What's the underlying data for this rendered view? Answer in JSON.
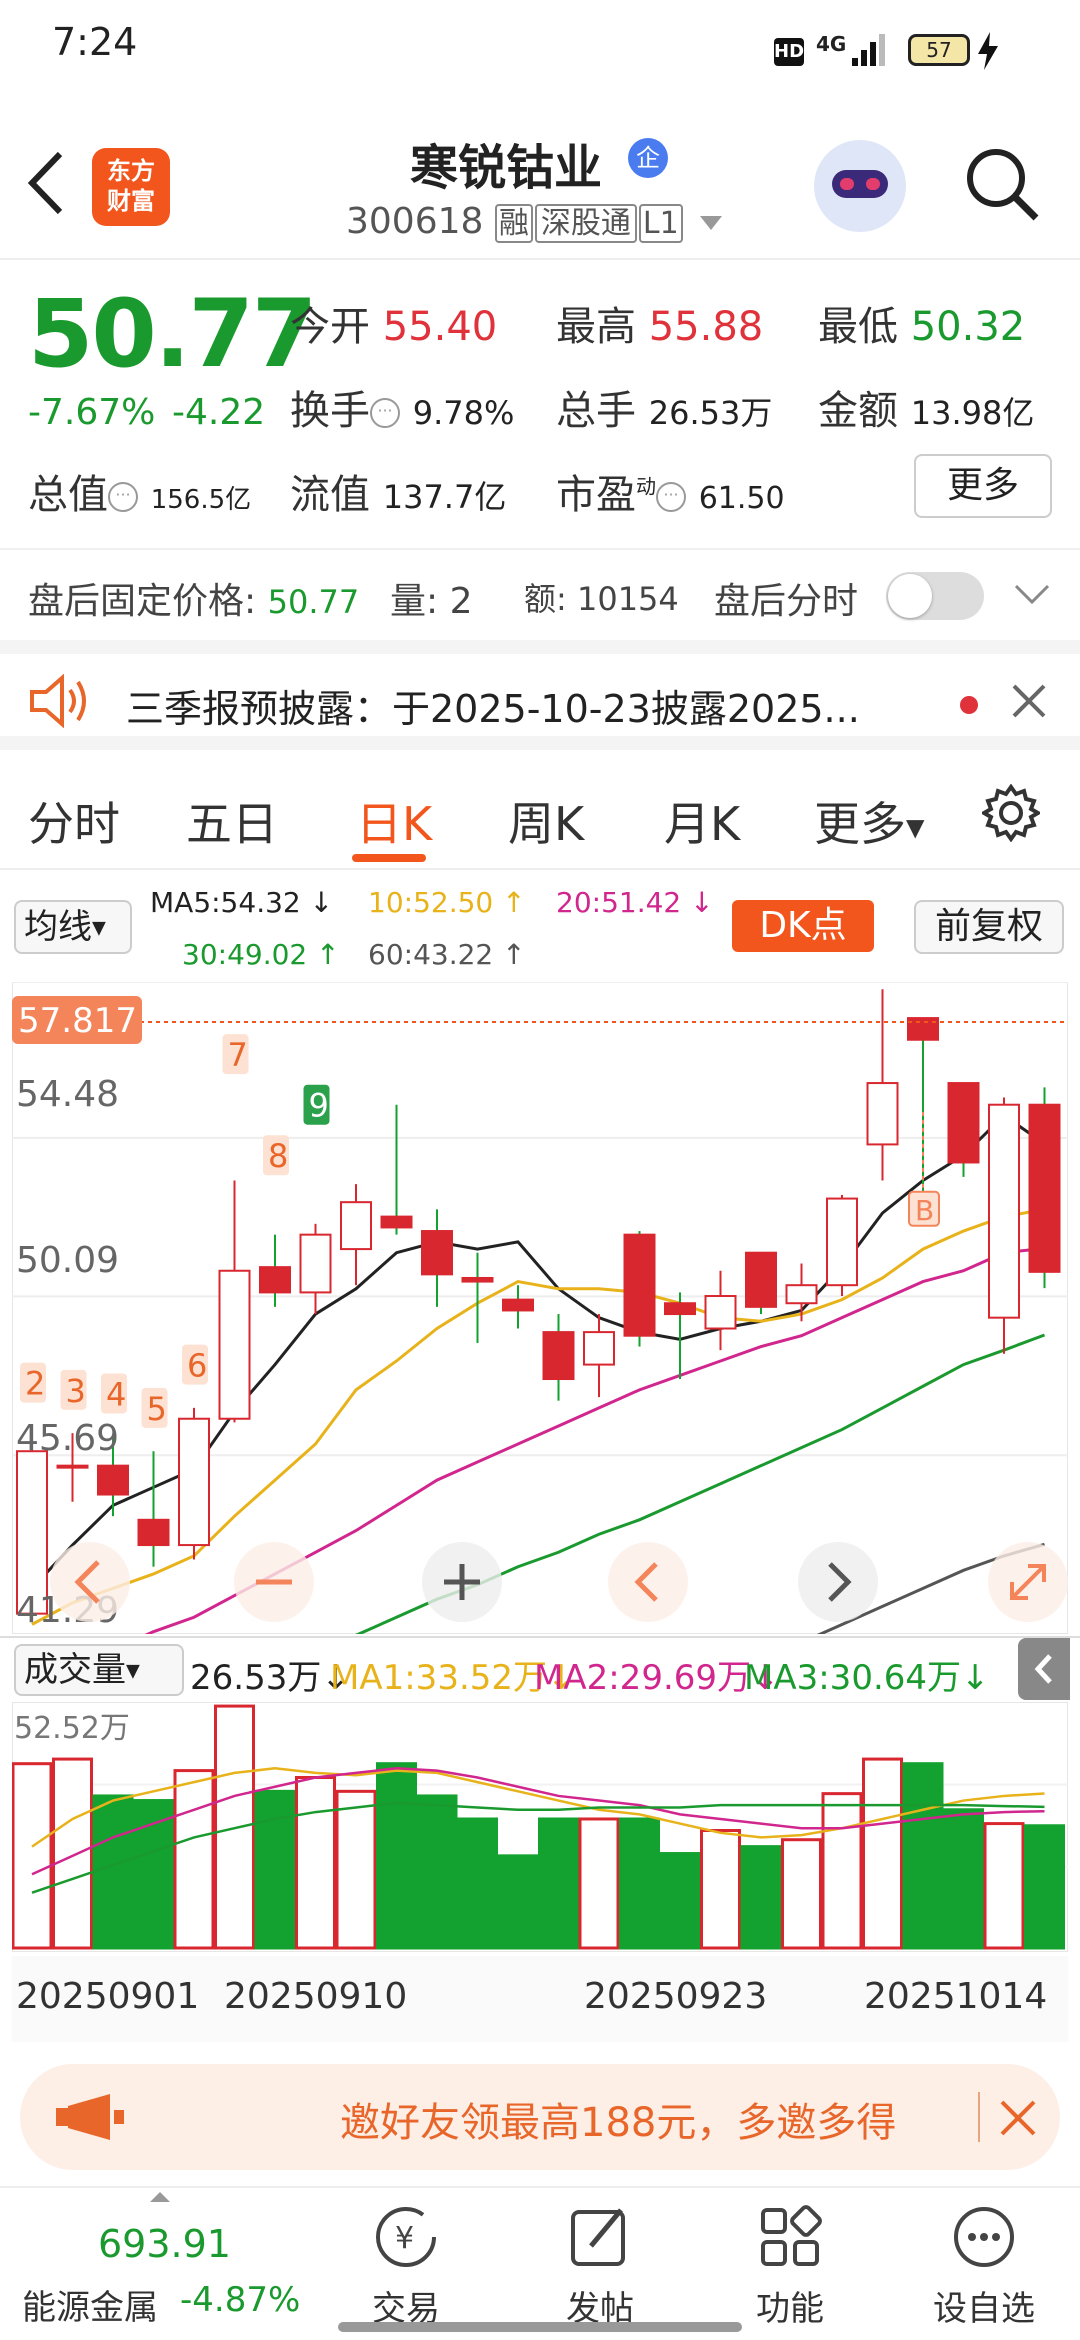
{
  "status_bar": {
    "time": "7:24",
    "hd": "HD",
    "network": "4G",
    "battery": "57"
  },
  "header": {
    "logo_line1": "东方",
    "logo_line2": "财富",
    "stock_name": "寒锐钴业",
    "enterprise_badge": "企",
    "stock_code": "300618",
    "tag_margin": "融",
    "tag_connect": "深股通",
    "tag_level": "L1"
  },
  "quote": {
    "price": "50.77",
    "change_pct": "-7.67%",
    "change_amt": "-4.22",
    "open_label": "今开",
    "open": "55.40",
    "high_label": "最高",
    "high": "55.88",
    "low_label": "最低",
    "low": "50.32",
    "turnover_label": "换手",
    "turnover": "9.78%",
    "volume_label": "总手",
    "volume": "26.53万",
    "amount_label": "金额",
    "amount": "13.98亿",
    "mktcap_label": "总值",
    "mktcap": "156.5亿",
    "float_label": "流值",
    "float_cap": "137.7亿",
    "pe_label": "市盈",
    "pe_super": "动",
    "pe": "61.50",
    "more_button": "更多"
  },
  "after_hours": {
    "fixed_price_label": "盘后固定价格:",
    "fixed_price": "50.77",
    "qty_label": "量:",
    "qty": "2",
    "amt_label": "额:",
    "amt": "10154",
    "timeshare_label": "盘后分时"
  },
  "notice": {
    "text": "三季报预披露：于2025-10-23披露2025..."
  },
  "tabs": [
    "分时",
    "五日",
    "日K",
    "周K",
    "月K",
    "更多"
  ],
  "active_tab": 2,
  "chart_toolbar": {
    "ma_select": "均线",
    "ma5": "MA5:54.32",
    "ma10": "10:52.50",
    "ma20": "20:51.42",
    "ma30": "30:49.02",
    "ma60": "60:43.22",
    "dk_button": "DK点",
    "adjust_button": "前复权"
  },
  "price_axis": {
    "current_tag": "57.817",
    "labels": [
      "54.48",
      "50.09",
      "45.69",
      "41.29"
    ]
  },
  "signals": [
    "2",
    "3",
    "4",
    "5",
    "6",
    "7",
    "8",
    "9"
  ],
  "buy_signal": "B",
  "volume_bar": {
    "select": "成交量",
    "volume": "26.53万",
    "ma1": "MA1:33.52万",
    "ma2": "MA2:29.69万",
    "ma3": "MA3:30.64万",
    "vol_axis": "52.52万"
  },
  "dates": [
    "20250901",
    "20250910",
    "20250923",
    "20251014"
  ],
  "promo": {
    "text": "邀好友领最高188元，多邀多得"
  },
  "bottom_nav": {
    "index_value": "693.91",
    "index_name": "能源金属",
    "index_change": "-4.87%",
    "items": [
      "交易",
      "发帖",
      "功能",
      "设自选"
    ]
  },
  "chart_data": {
    "type": "candlestick",
    "ylim": [
      41.29,
      58.8
    ],
    "candles": [
      {
        "o": 41.3,
        "c": 45.8,
        "h": 46.5,
        "l": 41.2
      },
      {
        "o": 45.4,
        "c": 45.4,
        "h": 46.3,
        "l": 44.4
      },
      {
        "o": 45.4,
        "c": 44.6,
        "h": 46.2,
        "l": 44.0
      },
      {
        "o": 43.9,
        "c": 43.2,
        "h": 45.8,
        "l": 42.6
      },
      {
        "o": 43.2,
        "c": 46.7,
        "h": 47.0,
        "l": 42.8
      },
      {
        "o": 46.7,
        "c": 50.8,
        "h": 53.3,
        "l": 46.6
      },
      {
        "o": 50.9,
        "c": 50.2,
        "h": 51.8,
        "l": 49.8
      },
      {
        "o": 50.2,
        "c": 51.8,
        "h": 52.1,
        "l": 49.6
      },
      {
        "o": 51.4,
        "c": 52.7,
        "h": 53.2,
        "l": 50.4
      },
      {
        "o": 52.3,
        "c": 52.0,
        "h": 55.4,
        "l": 51.8
      },
      {
        "o": 51.9,
        "c": 50.7,
        "h": 52.5,
        "l": 49.8
      },
      {
        "o": 50.6,
        "c": 50.5,
        "h": 51.3,
        "l": 48.8
      },
      {
        "o": 50.0,
        "c": 49.7,
        "h": 50.4,
        "l": 49.2
      },
      {
        "o": 49.1,
        "c": 47.8,
        "h": 49.6,
        "l": 47.2
      },
      {
        "o": 48.2,
        "c": 49.1,
        "h": 49.6,
        "l": 47.3
      },
      {
        "o": 51.8,
        "c": 49.0,
        "h": 51.9,
        "l": 48.7
      },
      {
        "o": 49.9,
        "c": 49.6,
        "h": 50.2,
        "l": 47.8
      },
      {
        "o": 49.2,
        "c": 50.1,
        "h": 50.8,
        "l": 48.6
      },
      {
        "o": 51.3,
        "c": 49.8,
        "h": 51.3,
        "l": 49.6
      },
      {
        "o": 49.9,
        "c": 50.4,
        "h": 51.0,
        "l": 49.4
      },
      {
        "o": 50.4,
        "c": 52.8,
        "h": 52.9,
        "l": 50.1
      },
      {
        "o": 54.3,
        "c": 56.0,
        "h": 58.6,
        "l": 53.3
      },
      {
        "o": 57.8,
        "c": 57.2,
        "h": 57.8,
        "l": 52.5
      },
      {
        "o": 56.0,
        "c": 53.8,
        "h": 56.0,
        "l": 53.4
      },
      {
        "o": 49.5,
        "c": 55.4,
        "h": 55.6,
        "l": 48.5
      },
      {
        "o": 55.4,
        "c": 50.77,
        "h": 55.88,
        "l": 50.32
      }
    ],
    "ma5": [
      42.0,
      43.2,
      44.3,
      44.8,
      45.3,
      46.9,
      48.2,
      49.6,
      50.3,
      51.3,
      51.6,
      51.4,
      51.6,
      50.3,
      49.5,
      49.1,
      48.9,
      49.2,
      49.4,
      49.7,
      50.9,
      52.4,
      53.3,
      54.0,
      55.1,
      54.32
    ],
    "ma10": [
      41.0,
      41.6,
      42.0,
      42.4,
      42.9,
      44.0,
      45.0,
      46.0,
      47.5,
      48.3,
      49.2,
      49.9,
      50.5,
      50.3,
      50.3,
      50.2,
      49.9,
      49.5,
      49.4,
      49.6,
      50.0,
      50.6,
      51.4,
      51.9,
      52.3,
      52.5
    ],
    "ma20": [
      39.5,
      39.8,
      40.3,
      40.8,
      41.2,
      41.8,
      42.4,
      43.0,
      43.6,
      44.3,
      45.0,
      45.5,
      46.0,
      46.5,
      47.0,
      47.5,
      47.9,
      48.3,
      48.7,
      49.0,
      49.5,
      50.0,
      50.5,
      50.8,
      51.3,
      51.42
    ],
    "ma30": [
      37.0,
      37.4,
      37.8,
      38.2,
      38.7,
      39.2,
      39.7,
      40.2,
      40.7,
      41.2,
      41.7,
      42.1,
      42.6,
      43.0,
      43.5,
      43.9,
      44.4,
      44.9,
      45.4,
      45.9,
      46.4,
      47.0,
      47.6,
      48.2,
      48.6,
      49.02
    ],
    "ma60": [
      null,
      null,
      null,
      null,
      null,
      null,
      null,
      null,
      null,
      null,
      null,
      null,
      null,
      null,
      null,
      null,
      null,
      null,
      null,
      40.5,
      41.0,
      41.5,
      42.0,
      42.5,
      42.9,
      43.22
    ],
    "volume": [
      40.0,
      41.0,
      33.0,
      32.0,
      38.5,
      52.5,
      34.0,
      37.0,
      34.0,
      40.0,
      33.0,
      28.0,
      20.0,
      28.0,
      28.0,
      28.0,
      20.5,
      25.5,
      22.0,
      23.5,
      33.5,
      41.0,
      40.0,
      30.0,
      27.0,
      26.53
    ],
    "vol_ma1": [
      22,
      28,
      32,
      34,
      36,
      38,
      39,
      38,
      37.5,
      38.5,
      38,
      36,
      34,
      32,
      30,
      29,
      27,
      25,
      24,
      24.5,
      26,
      28,
      30,
      32,
      33,
      33.52
    ],
    "vol_ma2": [
      16,
      20,
      24,
      27,
      30,
      33,
      35,
      37,
      38,
      39,
      38.5,
      37,
      35,
      33,
      32,
      31,
      29,
      28,
      27,
      26,
      26,
      27,
      28,
      29,
      29.5,
      29.69
    ],
    "vol_ma3": [
      12,
      15,
      18,
      21,
      24,
      26,
      28,
      29.5,
      30.5,
      31.5,
      31,
      30.5,
      30,
      30,
      30.5,
      30.5,
      30.5,
      31,
      31,
      31,
      31,
      31,
      31,
      31,
      30.8,
      30.64
    ]
  },
  "colors": {
    "up": "#d8272f",
    "down": "#13a22f",
    "accent": "#f2561d"
  }
}
